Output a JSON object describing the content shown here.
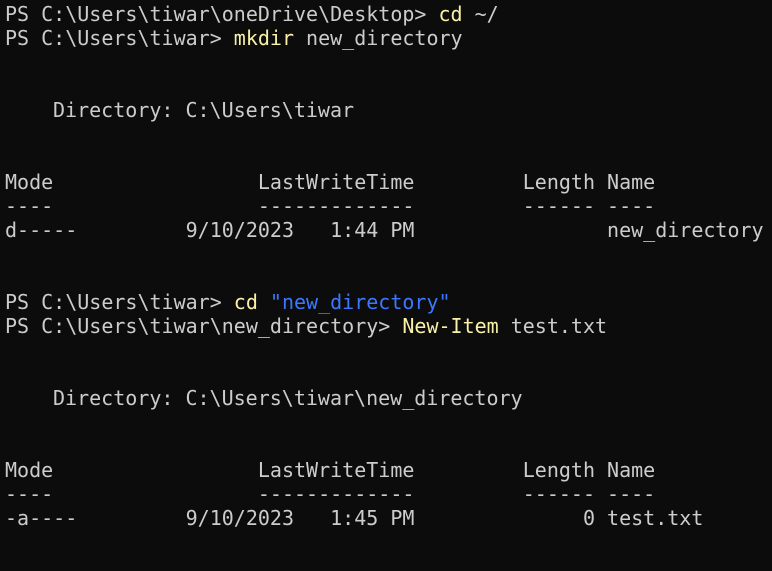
{
  "colors": {
    "background": "#0c0c0c",
    "foreground": "#cccccc",
    "command": "#f9f1a5",
    "string": "#3b78ff"
  },
  "lines": {
    "l1_prompt": "PS C:\\Users\\tiwar\\oneDrive\\Desktop> ",
    "l1_cmd": "cd",
    "l1_args": " ~/",
    "l2_prompt": "PS C:\\Users\\tiwar> ",
    "l2_cmd": "mkdir",
    "l2_args": " new_directory",
    "dir1": "Directory: C:\\Users\\tiwar",
    "table1_header": "Mode                 LastWriteTime         Length Name",
    "table1_sep": "----                 -------------         ------ ----",
    "table1_row": "d-----         9/10/2023   1:44 PM                new_directory",
    "l3_prompt": "PS C:\\Users\\tiwar> ",
    "l3_cmd": "cd",
    "l3_space": " ",
    "l3_string": "\"new_directory\"",
    "l4_prompt": "PS C:\\Users\\tiwar\\new_directory> ",
    "l4_cmd": "New-Item",
    "l4_args": " test.txt",
    "dir2": "Directory: C:\\Users\\tiwar\\new_directory",
    "table2_header": "Mode                 LastWriteTime         Length Name",
    "table2_sep": "----                 -------------         ------ ----",
    "table2_row": "-a----         9/10/2023   1:45 PM              0 test.txt"
  }
}
